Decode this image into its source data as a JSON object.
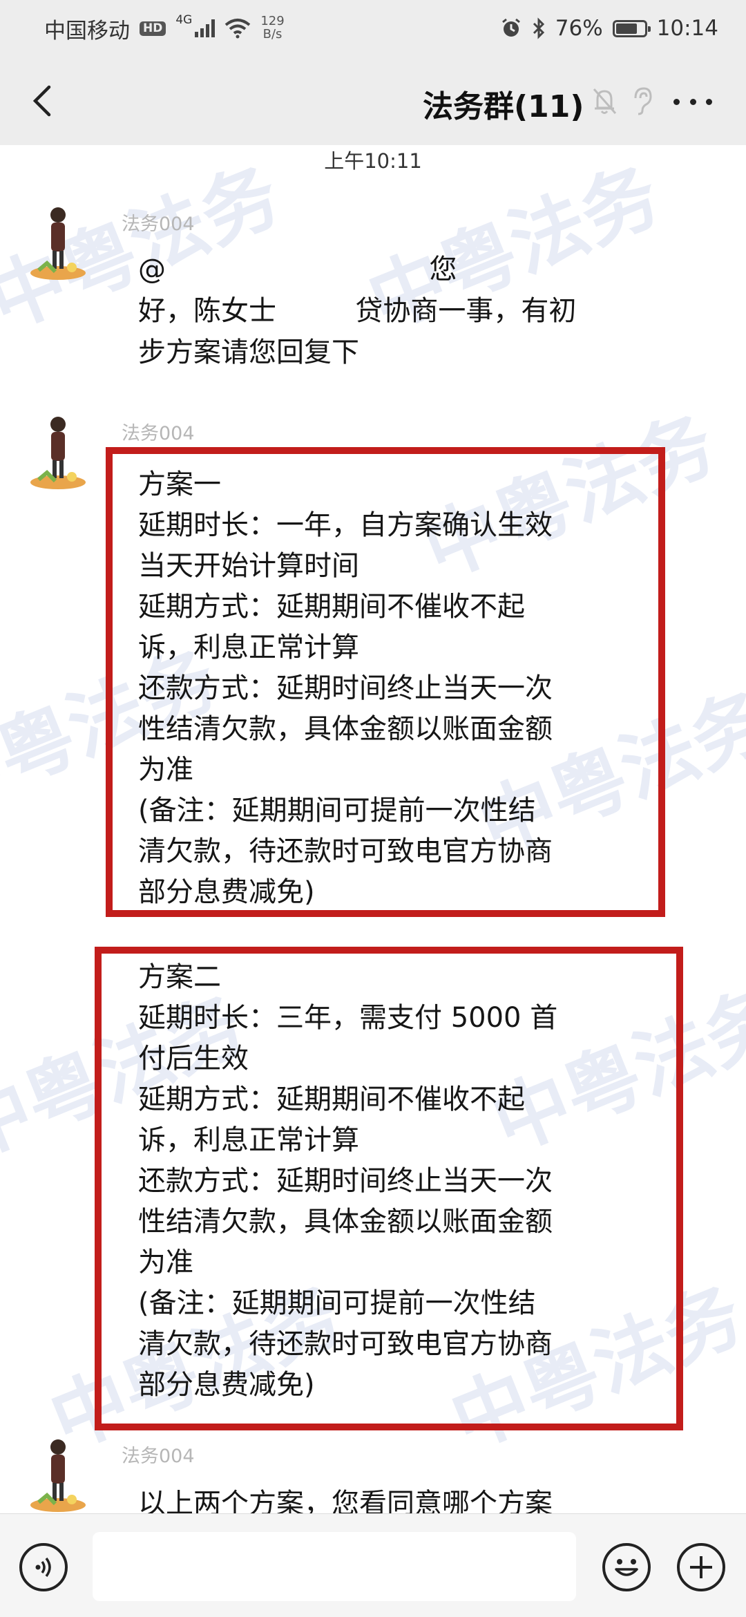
{
  "status_bar": {
    "carrier": "中国移动",
    "hd_label": "HD",
    "network_type": "4G",
    "net_speed_value": "129",
    "net_speed_unit": "B/s",
    "battery_level": 0.76,
    "battery_percent": "76%",
    "time": "10:14"
  },
  "nav": {
    "title": "法务群(11)"
  },
  "watermark_text": "中粤法务",
  "chat": {
    "timestamp": "上午10:11",
    "messages": [
      {
        "sender": "法务004",
        "lines": [
          "@                              您",
          "好，陈女士         贷协商一事，有初",
          "步方案请您回复下"
        ]
      },
      {
        "sender": "法务004",
        "lines": [
          "方案一",
          "延期时长：一年，自方案确认生效",
          "当天开始计算时间",
          "延期方式：延期期间不催收不起",
          "诉，利息正常计算",
          "还款方式：延期时间终止当天一次",
          "性结清欠款，具体金额以账面金额",
          "为准",
          "(备注：延期期间可提前一次性结",
          "清欠款，待还款时可致电官方协商",
          "部分息费减免)"
        ]
      },
      {
        "sender": "",
        "lines": [
          "方案二",
          "延期时长：三年，需支付 5000 首",
          "付后生效",
          "延期方式：延期期间不催收不起",
          "诉，利息正常计算",
          "还款方式：延期时间终止当天一次",
          "性结清欠款，具体金额以账面金额",
          "为准",
          "(备注：延期期间可提前一次性结",
          "清欠款，待还款时可致电官方协商",
          "部分息费减免)"
        ]
      },
      {
        "sender": "法务004",
        "lines": [
          "以上两个方案，您看同意哪个方案"
        ]
      }
    ]
  },
  "input": {
    "placeholder": ""
  },
  "colors": {
    "highlight_border": "#c21d1b",
    "watermark": "#5a78be",
    "background": "#ededed"
  },
  "icons": [
    "back-arrow-icon",
    "mute-bell-icon",
    "ear-icon",
    "more-dots-icon",
    "voice-icon",
    "emoji-icon",
    "plus-icon"
  ]
}
